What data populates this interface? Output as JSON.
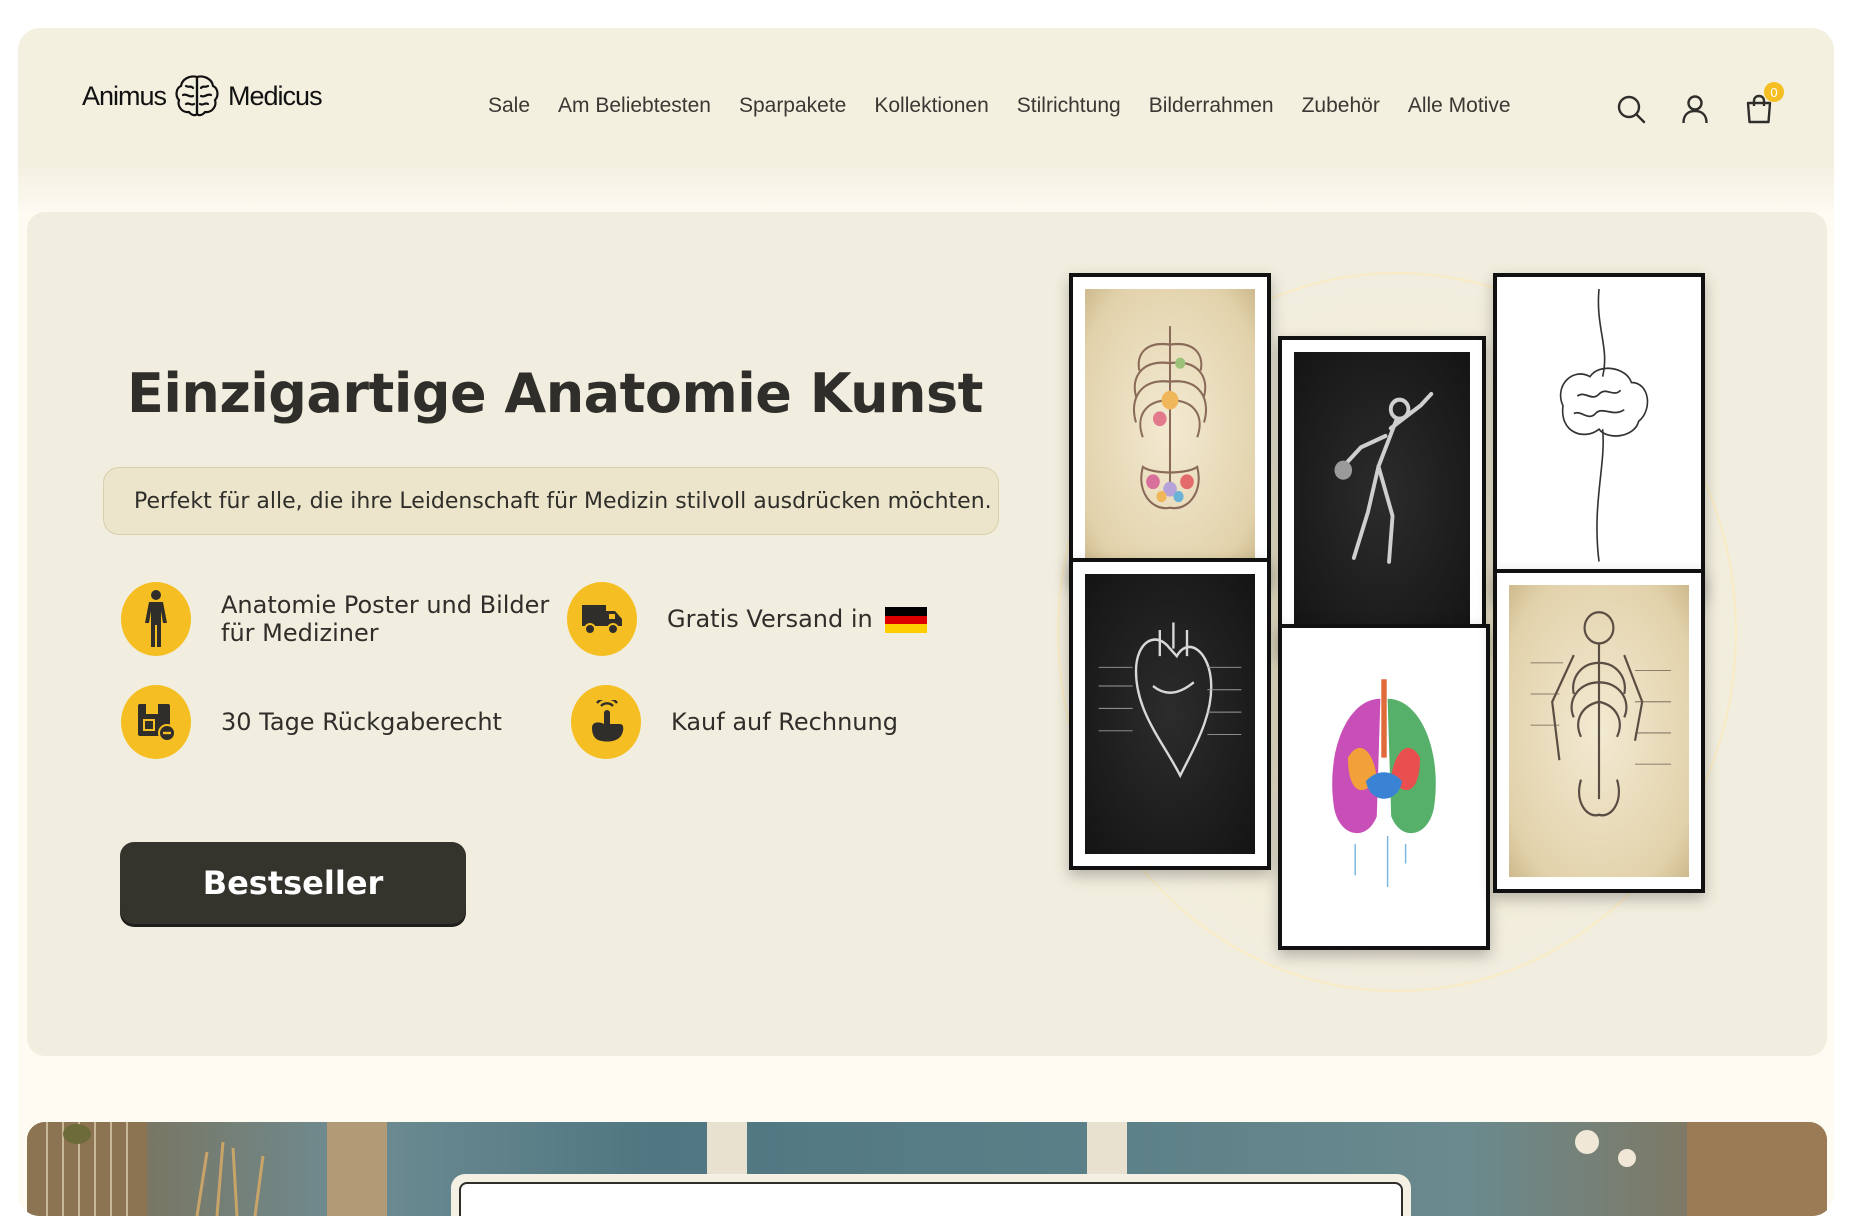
{
  "header": {
    "logo_left": "Animus",
    "logo_right": "Medicus",
    "nav": [
      "Sale",
      "Am Beliebtesten",
      "Sparpakete",
      "Kollektionen",
      "Stilrichtung",
      "Bilderrahmen",
      "Zubehör",
      "Alle Motive"
    ],
    "cart_count": "0"
  },
  "hero": {
    "title": "Einzigartige Anatomie Kunst",
    "subtitle": "Perfekt für alle, die ihre Leidenschaft für Medizin stilvoll ausdrücken möchten.",
    "features": {
      "posters": "Anatomie Poster und Bilder für Mediziner",
      "shipping": "Gratis Versand in",
      "returns": "30 Tage Rückgaberecht",
      "invoice": "Kauf auf Rechnung"
    },
    "cta_label": "Bestseller"
  },
  "colors": {
    "accent": "#f5bf24",
    "cta": "#34332c",
    "hero_bg": "#f2eedf",
    "header_bg": "#f3f0e0"
  },
  "icons": [
    "brain-logo-icon",
    "search-icon",
    "user-icon",
    "shopping-bag-icon",
    "human-body-icon",
    "delivery-truck-icon",
    "return-box-icon",
    "tap-hand-icon",
    "germany-flag-icon"
  ]
}
